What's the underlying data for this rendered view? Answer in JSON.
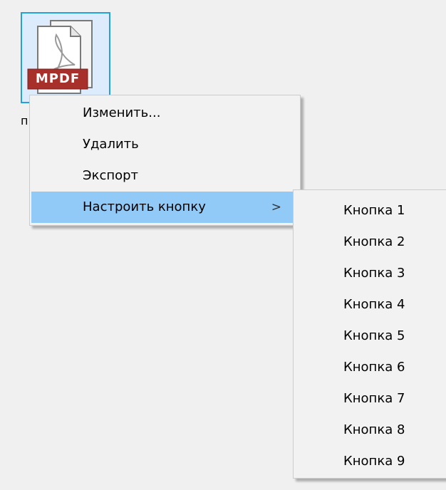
{
  "file": {
    "badge": "MPDF",
    "label_fragment": "п",
    "icon": "pdf-file-icon"
  },
  "context_menu": {
    "items": [
      {
        "label": "Изменить..."
      },
      {
        "label": "Удалить"
      },
      {
        "label": "Экспорт"
      },
      {
        "label": "Настроить кнопку",
        "arrow": ">",
        "highlighted": true
      }
    ]
  },
  "submenu": {
    "items": [
      {
        "label": "Кнопка 1"
      },
      {
        "label": "Кнопка 2"
      },
      {
        "label": "Кнопка 3"
      },
      {
        "label": "Кнопка 4"
      },
      {
        "label": "Кнопка 5"
      },
      {
        "label": "Кнопка 6"
      },
      {
        "label": "Кнопка 7"
      },
      {
        "label": "Кнопка 8"
      },
      {
        "label": "Кнопка 9"
      }
    ]
  },
  "colors": {
    "background": "#f0f0f0",
    "selection_border": "#26a0da",
    "menu_highlight": "#91c9f7",
    "pdf_badge": "#a8302b"
  }
}
